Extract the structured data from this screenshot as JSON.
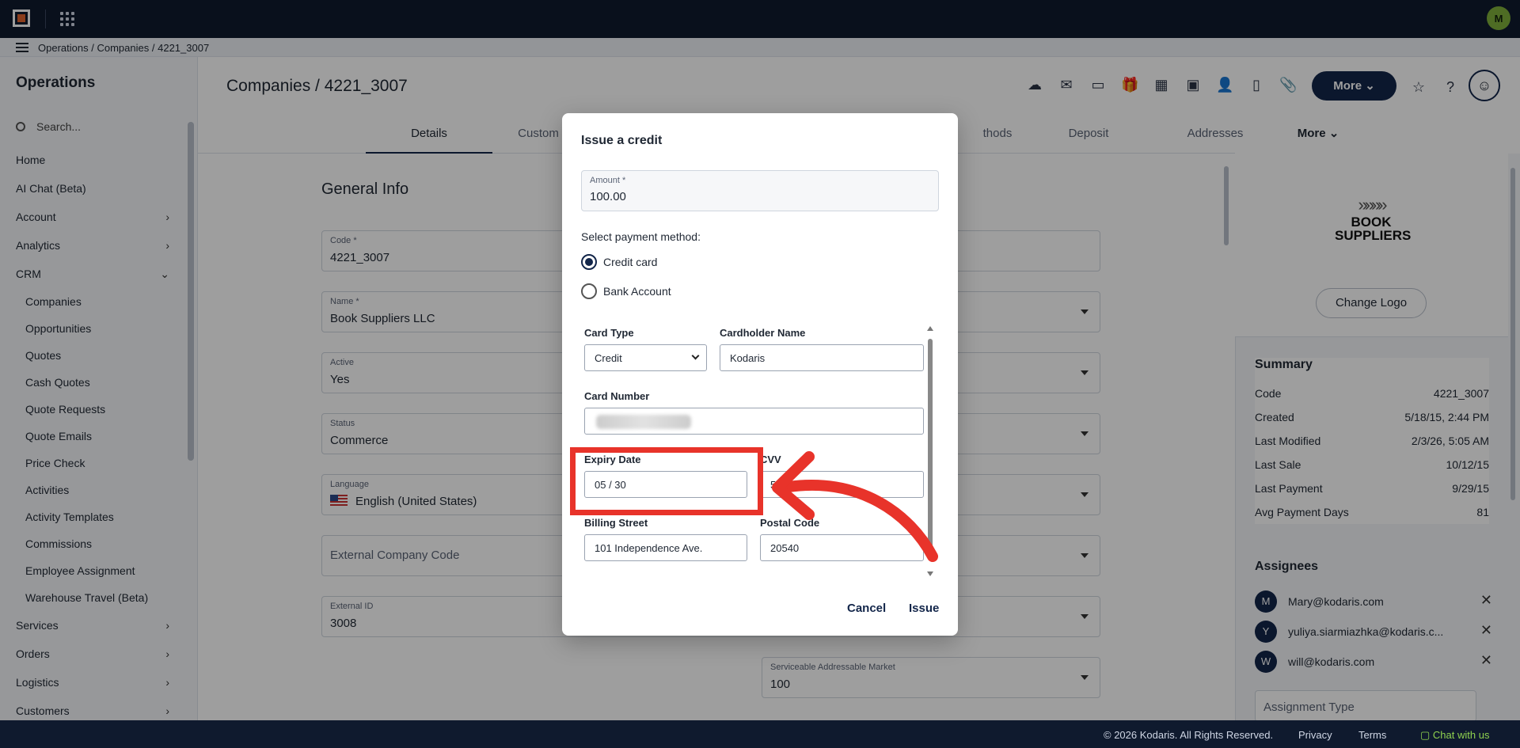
{
  "breadcrumb": [
    "Operations",
    "/",
    "Companies",
    "/",
    "4221_3007"
  ],
  "user_initial": "M",
  "sidebar": {
    "title": "Operations",
    "search_placeholder": "Search...",
    "items": [
      {
        "label": "Home",
        "sub": false,
        "chev": ""
      },
      {
        "label": "AI Chat (Beta)",
        "sub": false,
        "chev": ""
      },
      {
        "label": "Account",
        "sub": false,
        "chev": "›"
      },
      {
        "label": "Analytics",
        "sub": false,
        "chev": "›"
      },
      {
        "label": "CRM",
        "sub": false,
        "chev": "⌄"
      },
      {
        "label": "Companies",
        "sub": true,
        "chev": ""
      },
      {
        "label": "Opportunities",
        "sub": true,
        "chev": ""
      },
      {
        "label": "Quotes",
        "sub": true,
        "chev": ""
      },
      {
        "label": "Cash Quotes",
        "sub": true,
        "chev": ""
      },
      {
        "label": "Quote Requests",
        "sub": true,
        "chev": ""
      },
      {
        "label": "Quote Emails",
        "sub": true,
        "chev": ""
      },
      {
        "label": "Price Check",
        "sub": true,
        "chev": ""
      },
      {
        "label": "Activities",
        "sub": true,
        "chev": ""
      },
      {
        "label": "Activity Templates",
        "sub": true,
        "chev": ""
      },
      {
        "label": "Commissions",
        "sub": true,
        "chev": ""
      },
      {
        "label": "Employee Assignment",
        "sub": true,
        "chev": ""
      },
      {
        "label": "Warehouse Travel (Beta)",
        "sub": true,
        "chev": ""
      },
      {
        "label": "Services",
        "sub": false,
        "chev": "›"
      },
      {
        "label": "Orders",
        "sub": false,
        "chev": "›"
      },
      {
        "label": "Logistics",
        "sub": false,
        "chev": "›"
      },
      {
        "label": "Customers",
        "sub": false,
        "chev": "›"
      }
    ]
  },
  "header": {
    "title": "Companies / 4221_3007",
    "more_label": "More ⌄",
    "toolbar_icons": [
      "cloud-lock-icon",
      "mail-icon",
      "card-check-icon",
      "gift-icon",
      "building-add-icon",
      "screen-add-icon",
      "person-add-icon",
      "doc-add-icon",
      "paperclip-icon"
    ]
  },
  "tabs": [
    {
      "label": "Details",
      "active": true
    },
    {
      "label": "Custom",
      "active": false
    },
    {
      "label": "thods",
      "active": false
    },
    {
      "label": "Deposit",
      "active": false
    },
    {
      "label": "Addresses",
      "active": false
    },
    {
      "label": "More ⌄",
      "active": false
    }
  ],
  "form": {
    "section_title": "General Info",
    "code_label": "Code *",
    "code_value": "4221_3007",
    "name_label": "Name *",
    "name_value": "Book Suppliers LLC",
    "active_label": "Active",
    "active_value": "Yes",
    "status_label": "Status",
    "status_value": "Commerce",
    "language_label": "Language",
    "language_value": "English (United States)",
    "ext_code_placeholder": "External Company Code",
    "ext_id_label": "External ID",
    "ext_id_value": "3008",
    "sam_label": "Serviceable Addressable Market",
    "sam_value": "100"
  },
  "right_panel": {
    "logo_line1": "BOOK",
    "logo_line2": "SUPPLIERS",
    "change_logo": "Change Logo",
    "summary_title": "Summary",
    "summary": [
      {
        "k": "Code",
        "v": "4221_3007"
      },
      {
        "k": "Created",
        "v": "5/18/15, 2:44 PM"
      },
      {
        "k": "Last Modified",
        "v": "2/3/26, 5:05 AM"
      },
      {
        "k": "Last Sale",
        "v": "10/12/15"
      },
      {
        "k": "Last Payment",
        "v": "9/29/15"
      },
      {
        "k": "Avg Payment Days",
        "v": "81"
      }
    ],
    "assignees_title": "Assignees",
    "assignees": [
      {
        "initial": "M",
        "email": "Mary@kodaris.com"
      },
      {
        "initial": "Y",
        "email": "yuliya.siarmiazhka@kodaris.c..."
      },
      {
        "initial": "W",
        "email": "will@kodaris.com"
      }
    ],
    "assignment_type_placeholder": "Assignment Type"
  },
  "modal": {
    "title": "Issue a credit",
    "amount_label": "Amount *",
    "amount_value": "100.00",
    "payment_method_label": "Select payment method:",
    "credit_card": "Credit card",
    "bank_account": "Bank Account",
    "card_type_label": "Card Type",
    "card_type_value": "Credit",
    "cardholder_label": "Cardholder Name",
    "cardholder_value": "Kodaris",
    "card_number_label": "Card Number",
    "expiry_label": "Expiry Date",
    "expiry_value": "05 / 30",
    "cvv_label": "CVV",
    "cvv_value": "5",
    "billing_street_label": "Billing Street",
    "billing_street_value": "101 Independence Ave.",
    "postal_code_label": "Postal Code",
    "postal_code_value": "20540",
    "cancel": "Cancel",
    "issue": "Issue"
  },
  "footer": {
    "copyright": "© 2026 Kodaris. All Rights Reserved.",
    "privacy": "Privacy",
    "terms": "Terms",
    "chat": "Chat with us"
  },
  "colors": {
    "navy": "#13264a",
    "annotation_red": "#e8332a",
    "accent_green": "#8fd14f"
  }
}
